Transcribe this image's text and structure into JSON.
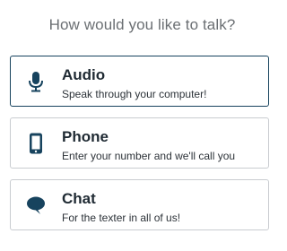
{
  "header": {
    "title": "How would you like to talk?"
  },
  "options": [
    {
      "label": "Audio",
      "description": "Speak through your computer!",
      "icon": "microphone-icon",
      "selected": true
    },
    {
      "label": "Phone",
      "description": "Enter your number and we'll call you",
      "icon": "mobile-phone-icon",
      "selected": false
    },
    {
      "label": "Chat",
      "description": "For the texter in all of us!",
      "icon": "chat-bubble-icon",
      "selected": false
    }
  ],
  "colors": {
    "icon": "#17435e",
    "selected_border": "#17435e",
    "border": "#c9ccd0",
    "title_text": "#6b6f73"
  }
}
